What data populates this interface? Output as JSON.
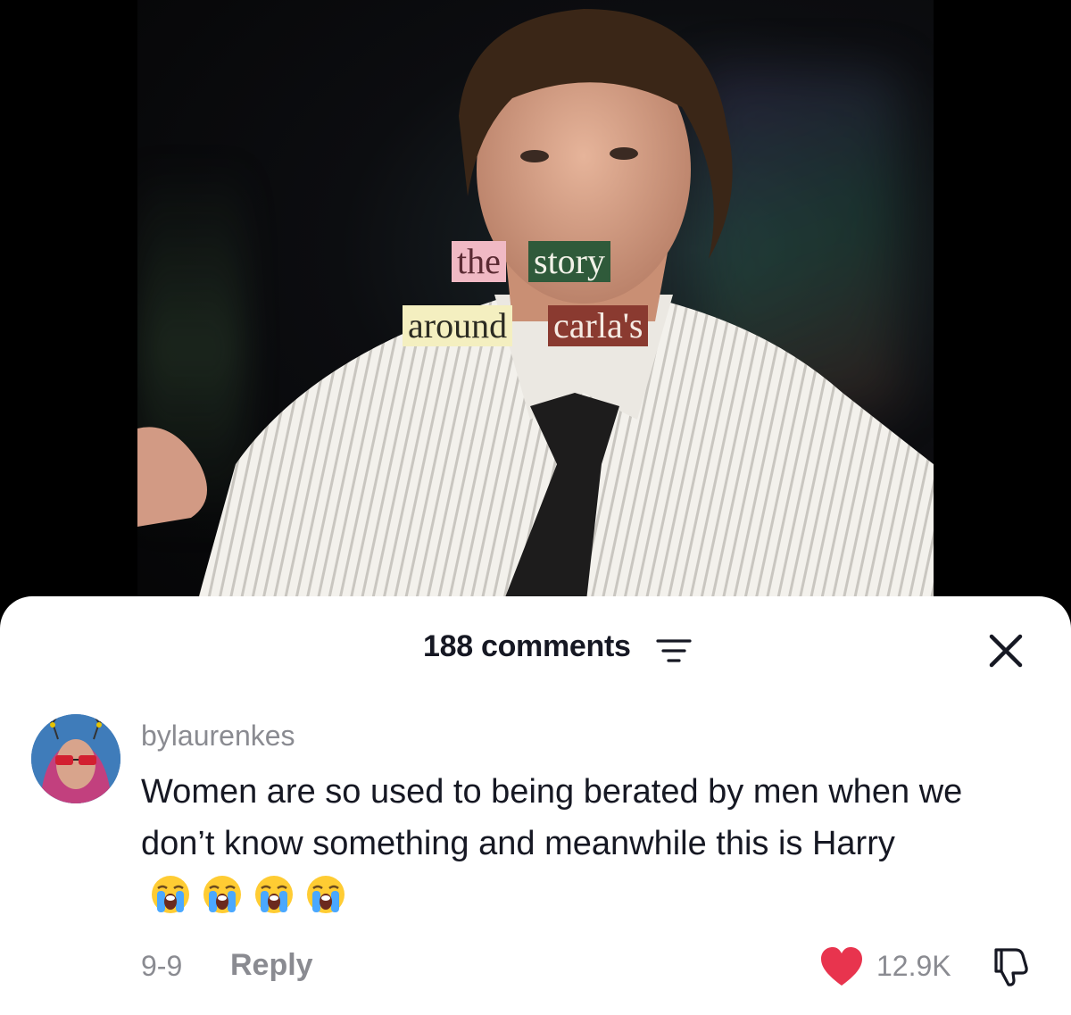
{
  "video": {
    "overlay_words": [
      {
        "text": "the",
        "bg": "#f0b9c4",
        "fg": "#5a2a32"
      },
      {
        "text": "story",
        "bg": "#2f5a3a",
        "fg": "#f2f2e8"
      },
      {
        "text": "around",
        "bg": "#f4efc0",
        "fg": "#2b2b22"
      },
      {
        "text": "carla's",
        "bg": "#8a3a30",
        "fg": "#f6ece4"
      }
    ]
  },
  "comments_panel": {
    "count_label": "188 comments",
    "filter_icon": "filter-lines-icon",
    "close_icon": "close-icon"
  },
  "comment": {
    "username": "bylaurenkes",
    "text": "Women are so used to being berated by men when we don’t know something and meanwhile this is Harry",
    "emoji": [
      "loudly-crying-face",
      "loudly-crying-face",
      "loudly-crying-face",
      "loudly-crying-face"
    ],
    "date": "9-9",
    "reply_label": "Reply",
    "like_count": "12.9K",
    "liked": true,
    "like_color": "#e8344e"
  }
}
